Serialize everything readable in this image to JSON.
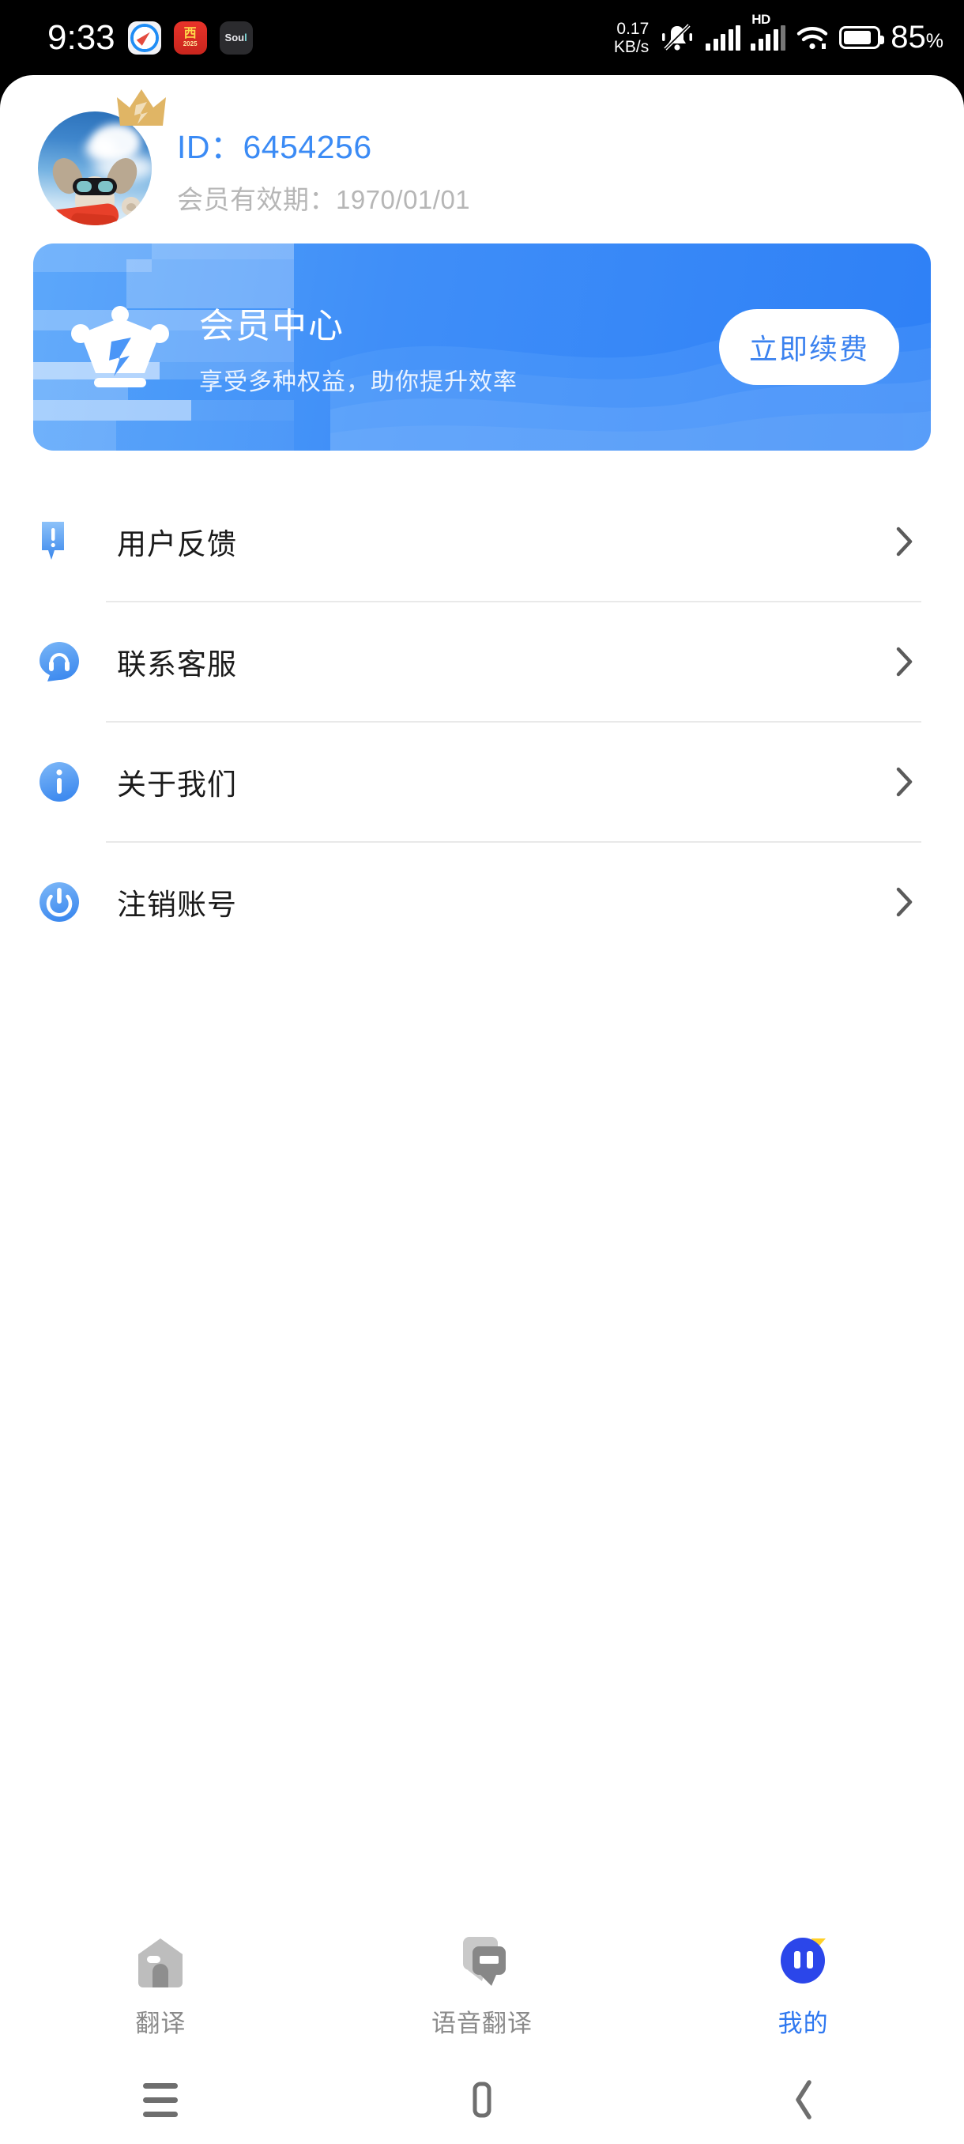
{
  "status_bar": {
    "clock": "9:33",
    "app_icons": [
      {
        "name": "safari-icon",
        "label": ""
      },
      {
        "name": "red-calendar-app-icon",
        "label": "西",
        "sub": "2025"
      },
      {
        "name": "soul-app-icon",
        "label": "Sou",
        "accent": "l"
      }
    ],
    "network_speed_value": "0.17",
    "network_speed_unit": "KB/s",
    "silent_mode_icon": "bell-muted-icon",
    "signal_1_icon": "signal-bars-icon",
    "hd_label": "HD",
    "signal_2_icon": "signal-bars-icon",
    "wifi_icon": "wifi-icon",
    "battery_icon": "battery-icon",
    "battery_percent": "85",
    "battery_percent_symbol": "%"
  },
  "profile": {
    "avatar_alt": "dog-with-goggles-avatar",
    "crown_badge_icon": "crown-badge-icon",
    "id_label": "ID：6454256",
    "membership_expiry": "会员有效期：1970/01/01"
  },
  "vip_banner": {
    "crown_icon": "crown-icon",
    "title": "会员中心",
    "subtitle": "享受多种权益，助你提升效率",
    "renew_button": "立即续费",
    "accent_color": "#3b8bf5"
  },
  "menu": {
    "items": [
      {
        "icon": "feedback-speech-bubble-icon",
        "label": "用户反馈",
        "chevron": "chevron-right-icon"
      },
      {
        "icon": "headset-support-icon",
        "label": "联系客服",
        "chevron": "chevron-right-icon"
      },
      {
        "icon": "info-circle-icon",
        "label": "关于我们",
        "chevron": "chevron-right-icon"
      },
      {
        "icon": "power-off-icon",
        "label": "注销账号",
        "chevron": "chevron-right-icon"
      }
    ]
  },
  "tab_bar": {
    "tabs": [
      {
        "icon": "home-house-icon",
        "label": "翻译",
        "active": false
      },
      {
        "icon": "speech-bubbles-icon",
        "label": "语音翻译",
        "active": false
      },
      {
        "icon": "profile-avatar-icon",
        "label": "我的",
        "active": true
      }
    ],
    "active_color": "#2f78f0",
    "inactive_color": "#8a8a8a"
  },
  "system_nav": {
    "recents_icon": "menu-recents-icon",
    "home_icon": "home-square-icon",
    "back_icon": "back-chevron-icon"
  }
}
